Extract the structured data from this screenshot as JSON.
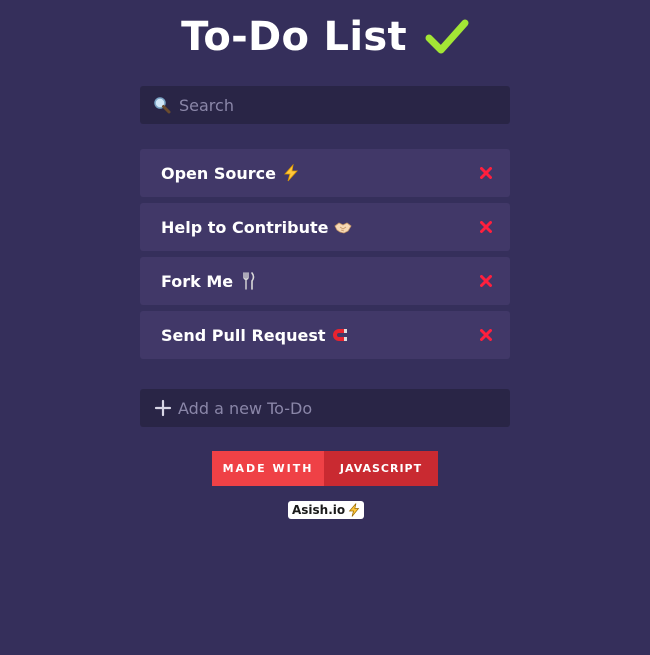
{
  "header": {
    "title": "To-Do List",
    "check_icon": "check-mark-icon",
    "check_color": "#a3e635"
  },
  "search": {
    "placeholder": "Search",
    "value": "",
    "icon": "magnifying-glass-icon"
  },
  "todos": [
    {
      "text": "Open Source",
      "emoji": "lightning-bolt-icon"
    },
    {
      "text": "Help to Contribute",
      "emoji": "handshake-icon"
    },
    {
      "text": "Fork Me",
      "emoji": "fork-and-knife-icon"
    },
    {
      "text": "Send Pull Request",
      "emoji": "magnet-icon"
    }
  ],
  "delete_icon": "red-x-icon",
  "add": {
    "placeholder": "Add a new To-Do",
    "value": "",
    "icon": "plus-icon"
  },
  "badge": {
    "left": "MADE WITH",
    "right": "JAVASCRIPT"
  },
  "credit": {
    "label": "Asish.io",
    "icon": "lightning-bolt-icon"
  },
  "colors": {
    "background": "#352f5b",
    "item": "#413868",
    "input": "#292546",
    "delete": "#ff1f3d",
    "badge_left": "#ef4146",
    "badge_right": "#c92a31"
  }
}
